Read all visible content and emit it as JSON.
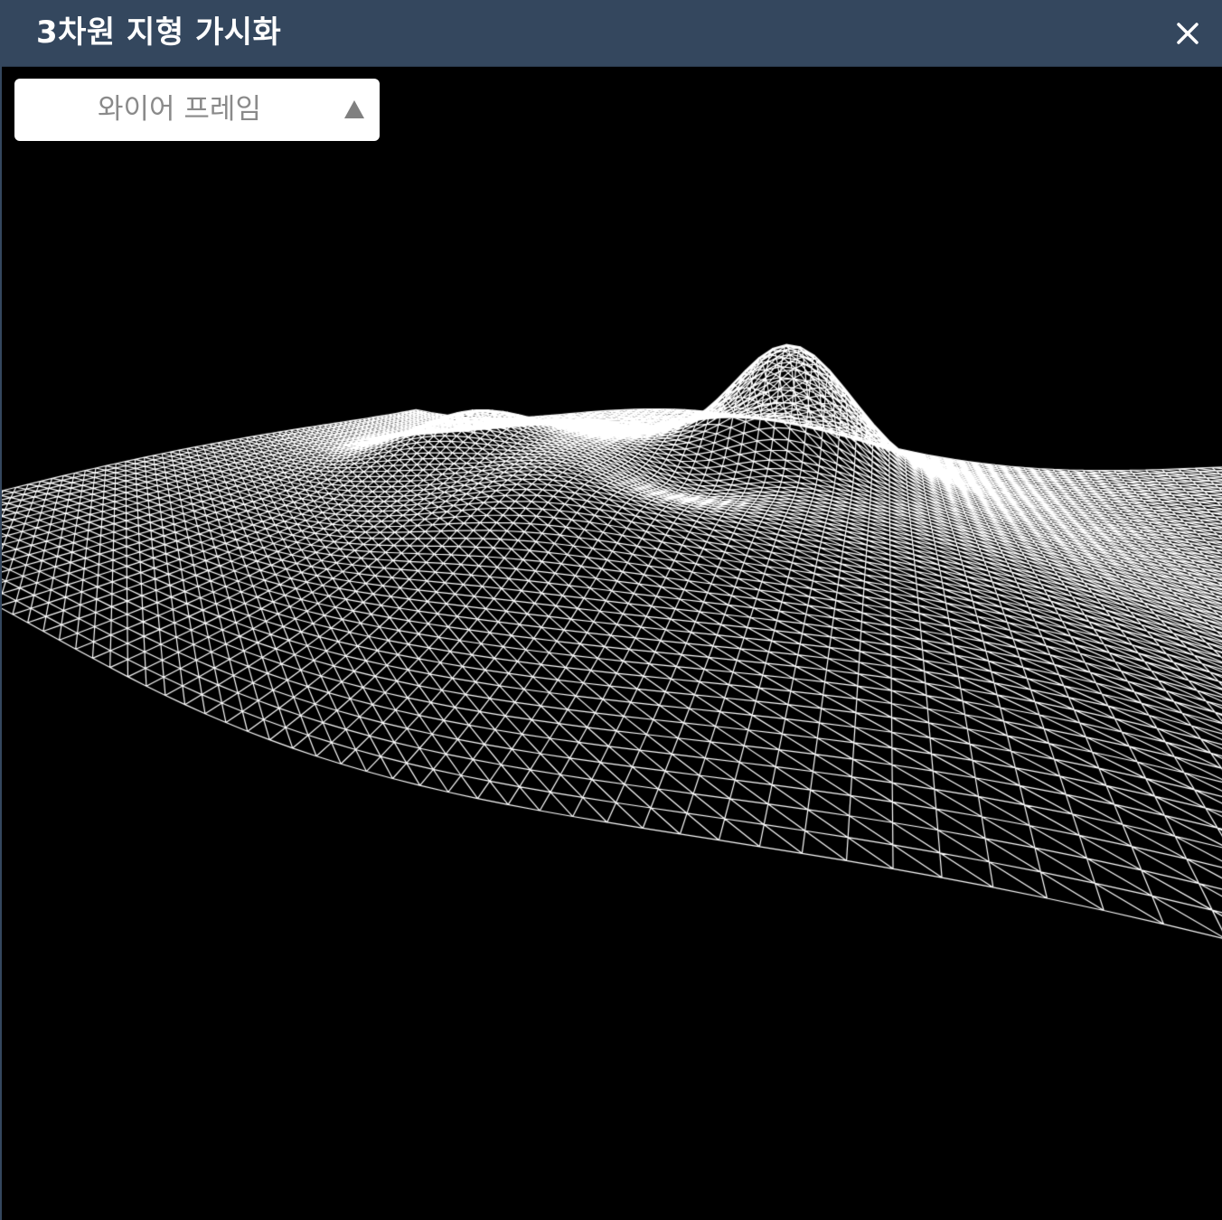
{
  "window": {
    "title": "3차원 지형 가시화",
    "close_icon": "close-icon",
    "titlebar_color": "#34475e"
  },
  "render_mode": {
    "selected": "와이어 프레임",
    "arrow_icon": "triangle-up-icon"
  },
  "viewport": {
    "background": "#000000",
    "mesh_color": "#ffffff",
    "style": "triangulated wireframe"
  }
}
